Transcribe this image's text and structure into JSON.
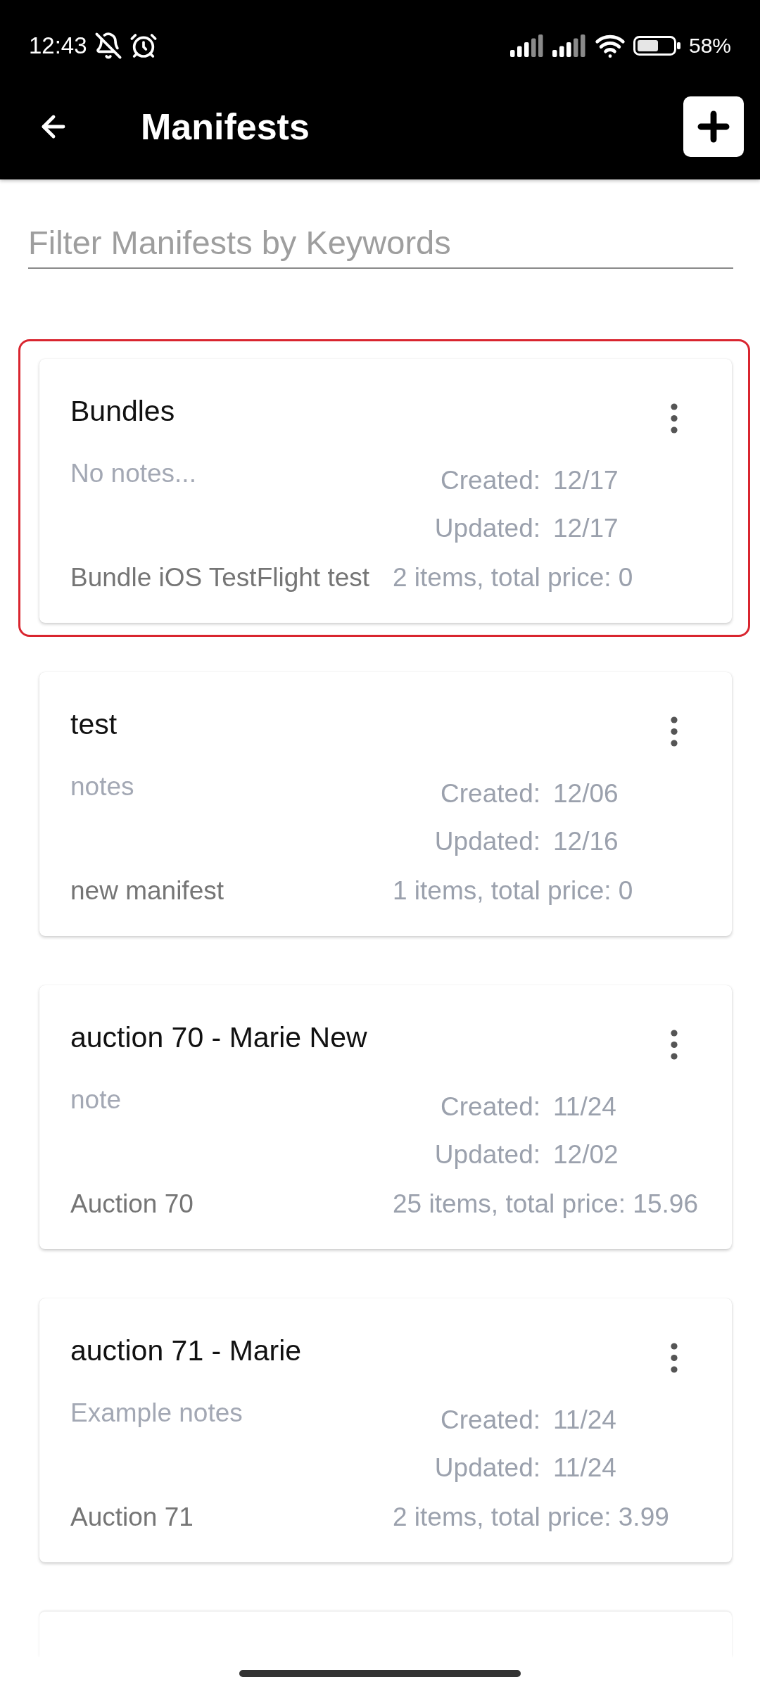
{
  "status_bar": {
    "time": "12:43",
    "battery": "58%"
  },
  "app_bar": {
    "title": "Manifests"
  },
  "filter": {
    "placeholder": "Filter Manifests by Keywords"
  },
  "manifests": [
    {
      "title": "Bundles",
      "notes": "No notes...",
      "created_label": "Created:",
      "created": "12/17",
      "updated_label": "Updated:",
      "updated": "12/17",
      "description": "Bundle iOS TestFlight test",
      "summary": "2 items, total price: 0",
      "selected": true
    },
    {
      "title": "test",
      "notes": "notes",
      "created_label": "Created:",
      "created": "12/06",
      "updated_label": "Updated:",
      "updated": "12/16",
      "description": "new manifest",
      "summary": "1 items, total price: 0",
      "selected": false
    },
    {
      "title": "auction 70 - Marie New",
      "notes": "note",
      "created_label": "Created:",
      "created": "11/24",
      "updated_label": "Updated:",
      "updated": "12/02",
      "description": "Auction 70",
      "summary": "25 items, total price: 15.96",
      "selected": false
    },
    {
      "title": "auction 71 - Marie",
      "notes": "Example notes",
      "created_label": "Created:",
      "created": "11/24",
      "updated_label": "Updated:",
      "updated": "11/24",
      "description": "Auction 71",
      "summary": "2 items, total price: 3.99",
      "selected": false
    }
  ]
}
